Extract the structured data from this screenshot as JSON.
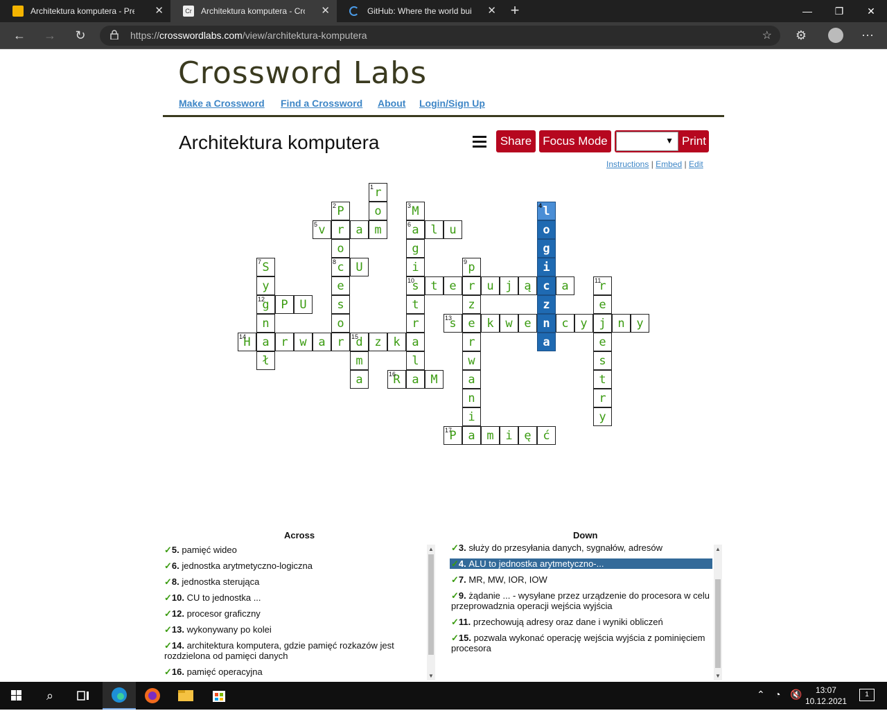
{
  "browser": {
    "tabs": [
      {
        "title": "Architektura komputera - Prezen",
        "icon": "slides-icon"
      },
      {
        "title": "Architektura komputera - Crossw",
        "icon": "crosswordlabs-icon"
      },
      {
        "title": "GitHub: Where the world builds s",
        "icon": "loading-icon"
      }
    ],
    "url_prefix": "https://",
    "url_domain": "crosswordlabs.com",
    "url_path": "/view/architektura-komputera"
  },
  "site": {
    "logo": "Crossword Labs",
    "links": [
      "Make a Crossword",
      "Find a Crossword",
      "About",
      "Login/Sign Up"
    ]
  },
  "puzzle": {
    "title": "Architektura komputera",
    "share_label": "Share",
    "focus_label": "Focus Mode",
    "print_label": "Print",
    "instructions_label": "Instructions",
    "embed_label": "Embed",
    "edit_label": "Edit",
    "sep": "|"
  },
  "grid": {
    "words": [
      {
        "num": 1,
        "dir": "down",
        "row": 0,
        "col": 7,
        "text": "ro"
      },
      {
        "num": 2,
        "dir": "down",
        "row": 1,
        "col": 5,
        "text": "Procesor"
      },
      {
        "num": 3,
        "dir": "down",
        "row": 1,
        "col": 9,
        "text": "Magistrala"
      },
      {
        "num": 4,
        "dir": "down",
        "row": 1,
        "col": 16,
        "text": "logiczna"
      },
      {
        "num": 5,
        "dir": "across",
        "row": 2,
        "col": 4,
        "text": "vram"
      },
      {
        "num": 6,
        "dir": "across",
        "row": 2,
        "col": 9,
        "text": "alu"
      },
      {
        "num": 7,
        "dir": "down",
        "row": 4,
        "col": 1,
        "text": "Sygnał"
      },
      {
        "num": 8,
        "dir": "across",
        "row": 4,
        "col": 5,
        "text": "CU"
      },
      {
        "num": 9,
        "dir": "down",
        "row": 4,
        "col": 12,
        "text": "przerwania"
      },
      {
        "num": 10,
        "dir": "across",
        "row": 5,
        "col": 9,
        "text": "sterująca"
      },
      {
        "num": 11,
        "dir": "down",
        "row": 5,
        "col": 19,
        "text": "rejestry"
      },
      {
        "num": 12,
        "dir": "across",
        "row": 6,
        "col": 1,
        "text": "GPU"
      },
      {
        "num": 13,
        "dir": "across",
        "row": 7,
        "col": 11,
        "text": "sekwencyjny"
      },
      {
        "num": 14,
        "dir": "across",
        "row": 8,
        "col": 0,
        "text": "Harwardzka"
      },
      {
        "num": 15,
        "dir": "down",
        "row": 8,
        "col": 6,
        "text": "dma"
      },
      {
        "num": 16,
        "dir": "across",
        "row": 10,
        "col": 8,
        "text": "RaM"
      },
      {
        "num": 17,
        "dir": "across",
        "row": 13,
        "col": 11,
        "text": "Pamięć"
      }
    ],
    "highlight_word": 4
  },
  "clues": {
    "across_title": "Across",
    "down_title": "Down",
    "checkmark": "✓",
    "across": [
      {
        "num": "5.",
        "text": "pamięć wideo"
      },
      {
        "num": "6.",
        "text": "jednostka arytmetyczno-logiczna"
      },
      {
        "num": "8.",
        "text": "jednostka sterująca"
      },
      {
        "num": "10.",
        "text": "CU to jednostka ..."
      },
      {
        "num": "12.",
        "text": "procesor graficzny"
      },
      {
        "num": "13.",
        "text": "wykonywany po kolei"
      },
      {
        "num": "14.",
        "text": "architektura komputera, gdzie pamięć rozkazów jest rozdzielona od pamięci danych"
      },
      {
        "num": "16.",
        "text": "pamięć operacyjna"
      }
    ],
    "down": [
      {
        "num": "3.",
        "text": "służy do przesyłania danych, sygnałów, adresów"
      },
      {
        "num": "4.",
        "text": "ALU to jednostka arytmetyczno-...",
        "selected": true
      },
      {
        "num": "7.",
        "text": "MR, MW, IOR, IOW"
      },
      {
        "num": "9.",
        "text": "żądanie ... - wysyłane przez urządzenie do procesora w celu przeprowadznia operacji wejścia wyjścia"
      },
      {
        "num": "11.",
        "text": "przechowują adresy oraz dane i wyniki obliczeń"
      },
      {
        "num": "15.",
        "text": "pozwala wykonać operację wejścia wyjścia z pominięciem procesora"
      }
    ]
  },
  "taskbar": {
    "time": "13:07",
    "date": "10.12.2021",
    "notif_count": "1"
  }
}
